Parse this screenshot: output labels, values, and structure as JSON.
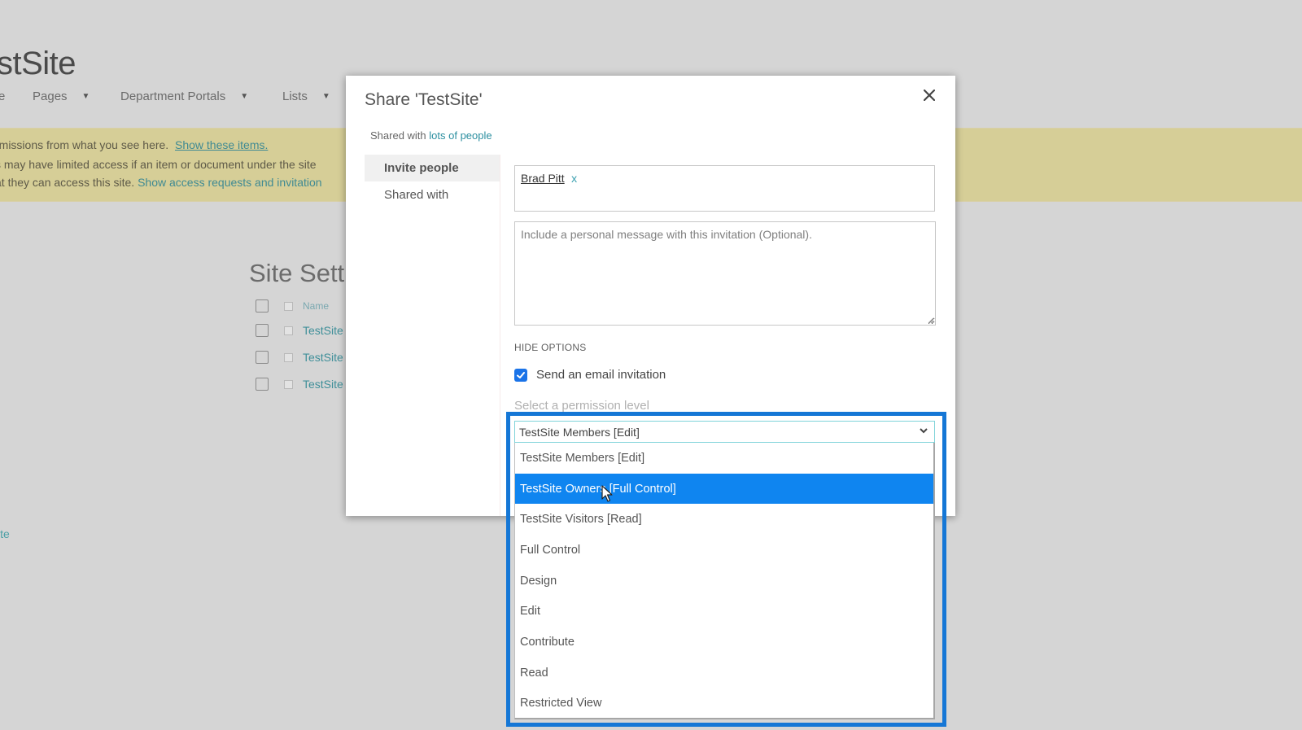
{
  "background": {
    "site_title": "stSite",
    "nav": [
      {
        "label": "e",
        "has_caret": false
      },
      {
        "label": "Pages",
        "has_caret": true
      },
      {
        "label": "Department Portals",
        "has_caret": true
      },
      {
        "label": "Lists",
        "has_caret": true
      }
    ],
    "banner": {
      "line1_text": "rmissions from what you see here.",
      "line1_link": "Show these items.",
      "line2_text": "s may have limited access if an item or document under the site",
      "line3_text": "at they can access this site.",
      "line3_link": "Show access requests and invitation"
    },
    "settings_title": "Site Sett",
    "table_header": "Name",
    "rows": [
      "TestSite",
      "TestSite",
      "TestSite"
    ],
    "left_link": "ite",
    "accent_color": "#3f8f99"
  },
  "modal": {
    "title": "Share 'TestSite'",
    "close_icon": "close-icon",
    "shared_with_prefix": "Shared with",
    "shared_with_link": "lots of people",
    "tabs": [
      {
        "label": "Invite people",
        "active": true
      },
      {
        "label": "Shared with",
        "active": false
      }
    ],
    "people_picker": {
      "tokens": [
        {
          "name": "Brad Pitt",
          "remove": "x"
        }
      ]
    },
    "message": {
      "value": "",
      "placeholder": "Include a personal message with this invitation (Optional)."
    },
    "hide_options_label": "HIDE OPTIONS",
    "send_email": {
      "label": "Send an email invitation",
      "checked": true
    },
    "permission_label": "Select a permission level",
    "permission_select": {
      "selected_value": "TestSite Members [Edit]",
      "highlighted_index": 1,
      "options": [
        "TestSite Members [Edit]",
        "TestSite Owners [Full Control]",
        "TestSite Visitors [Read]",
        "Full Control",
        "Design",
        "Edit",
        "Contribute",
        "Read",
        "Restricted View"
      ]
    }
  },
  "colors": {
    "highlight_frame": "#1577d6",
    "selected_option": "#0f85f0",
    "banner": "#d6ce97",
    "checkbox": "#1a73e8"
  }
}
